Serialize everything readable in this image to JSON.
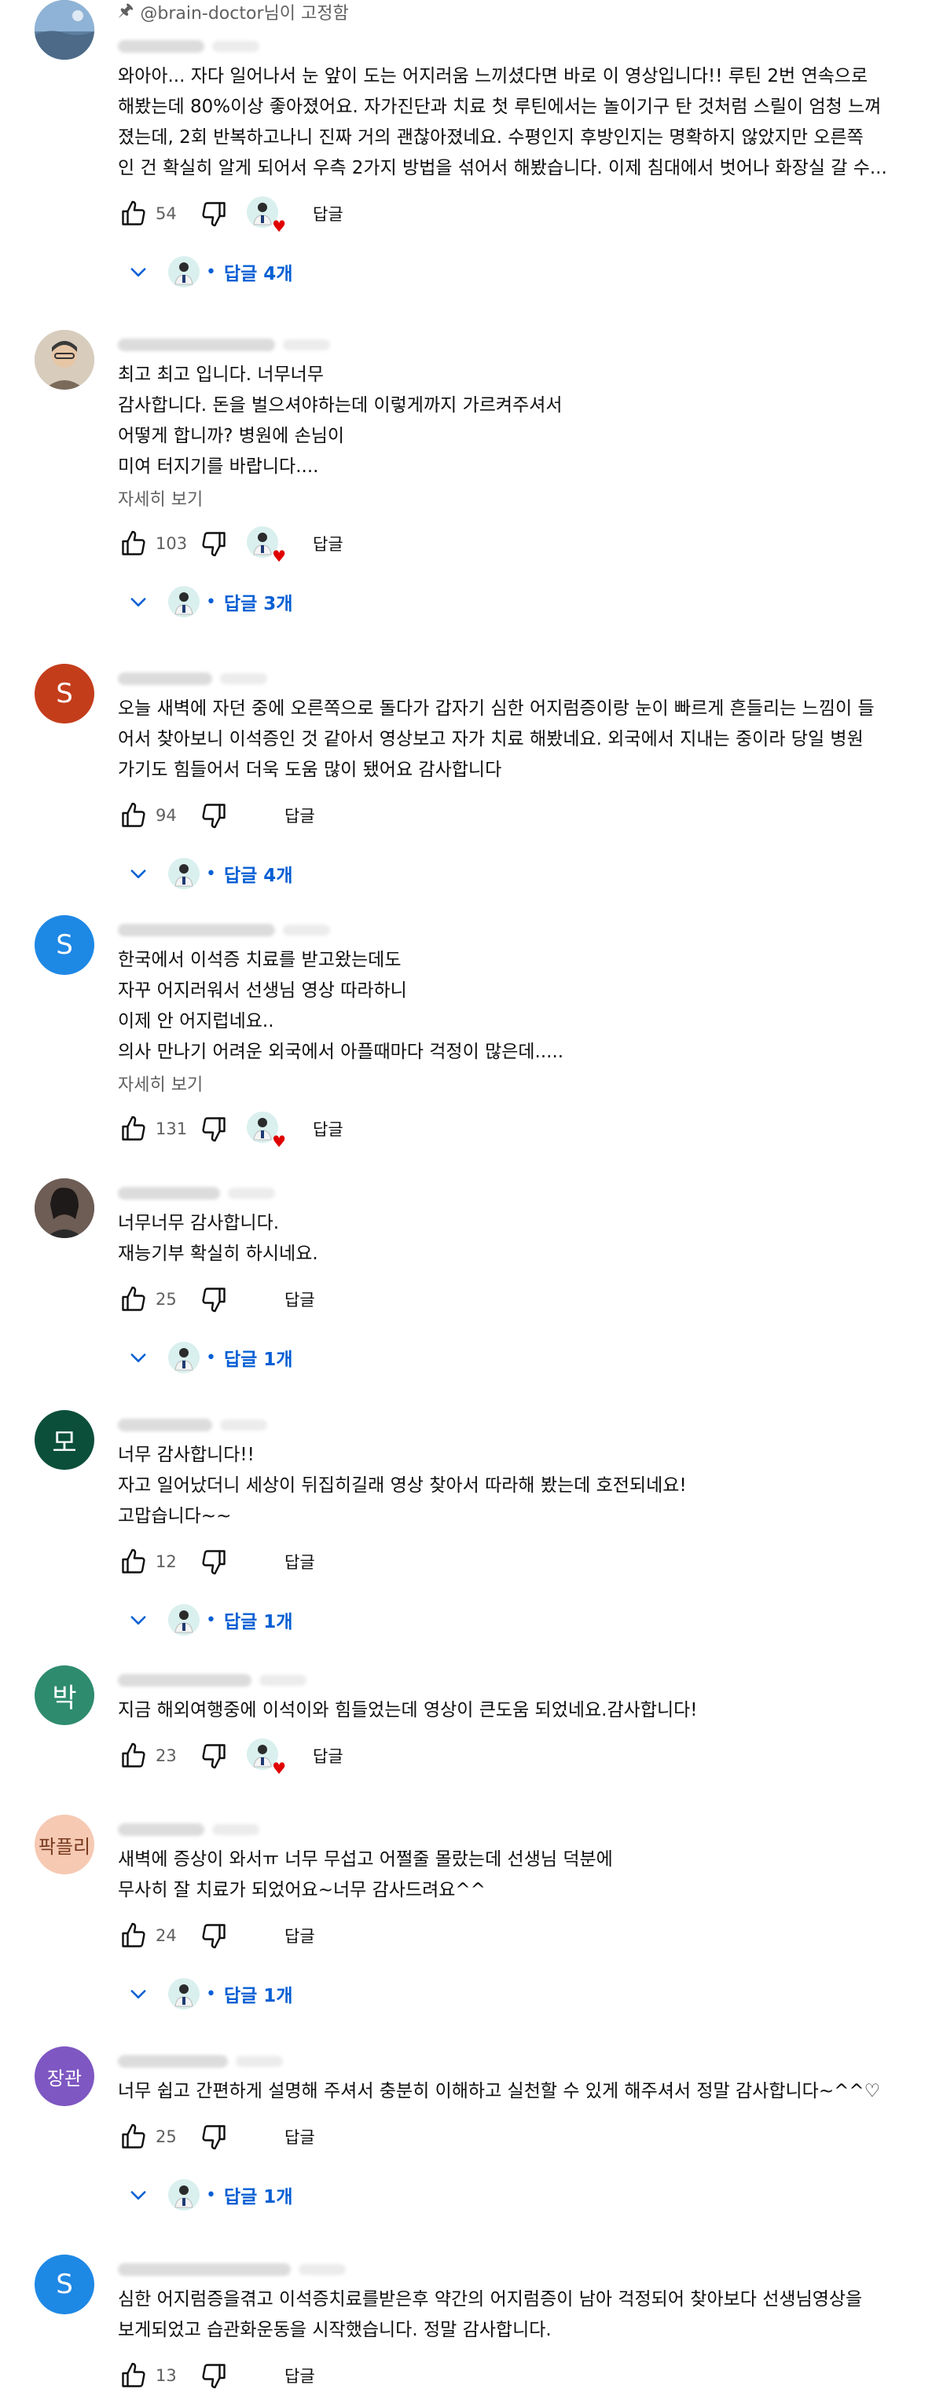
{
  "pinned_label": "@brain-doctor님이 고정함",
  "reply_label": "답글",
  "more_label": "자세히 보기",
  "colors": {
    "link_blue": "#065fd4",
    "heart_red": "#e00000",
    "secondary_text": "#606060"
  },
  "comments": [
    {
      "avatar_letter": "",
      "avatar_color": "#6f8fb3",
      "pinned": true,
      "lines": [
        "와아아... 자다 일어나서 눈 앞이 도는 어지러움 느끼셨다면 바로 이 영상입니다!! 루틴 2번 연속으로",
        "해봤는데 80%이상 좋아졌어요. 자가진단과 치료 첫 루틴에서는 놀이기구 탄 것처럼 스릴이 엄청 느껴",
        "졌는데, 2회 반복하고나니 진짜 거의 괜찮아졌네요. 수평인지 후방인지는 명확하지 않았지만 오른쪽",
        "인 건 확실히 알게 되어서 우측 2가지 방법을 섞어서 해봤습니다. 이제 침대에서 벗어나 화장실 갈 수..."
      ],
      "more": false,
      "likes": "54",
      "heart": true,
      "replies": "답글 4개"
    },
    {
      "avatar_letter": "",
      "avatar_color": "#b7a58f",
      "pinned": false,
      "lines": [
        "최고 최고 입니다.  너무너무",
        "감사합니다. 돈을 벌으셔야하는데 이렇게까지 가르켜주셔서",
        "어떻게 합니까? 병원에 손님이",
        "미여 터지기를 바랍니다...."
      ],
      "more": true,
      "likes": "103",
      "heart": true,
      "replies": "답글 3개"
    },
    {
      "avatar_letter": "S",
      "avatar_color": "#c43d1b",
      "pinned": false,
      "lines": [
        "오늘 새벽에 자던 중에 오른쪽으로 돌다가 갑자기 심한 어지럼증이랑 눈이 빠르게 흔들리는 느낌이 들",
        "어서 찾아보니 이석증인 것 같아서 영상보고 자가 치료 해봤네요. 외국에서 지내는 중이라 당일 병원",
        "가기도 힘들어서 더욱 도움 많이 됐어요 감사합니다"
      ],
      "more": false,
      "likes": "94",
      "heart": false,
      "replies": "답글 4개"
    },
    {
      "avatar_letter": "S",
      "avatar_color": "#1e88e5",
      "pinned": false,
      "lines": [
        "한국에서 이석증 치료를 받고왔는데도",
        "자꾸 어지러워서 선생님 영상 따라하니",
        "이제 안 어지럽네요..",
        "의사 만나기 어려운 외국에서 아플때마다 걱정이 많은데....."
      ],
      "more": true,
      "likes": "131",
      "heart": true,
      "replies": ""
    },
    {
      "avatar_letter": "",
      "avatar_color": "#5a4a44",
      "pinned": false,
      "lines": [
        "너무너무 감사합니다.",
        "재능기부 확실히 하시네요."
      ],
      "more": false,
      "likes": "25",
      "heart": false,
      "replies": "답글 1개"
    },
    {
      "avatar_letter": "모",
      "avatar_color": "#0b4f3a",
      "pinned": false,
      "lines": [
        "너무 감사합니다!!",
        "자고 일어났더니  세상이 뒤집히길래 영상 찾아서 따라해 봤는데 호전되네요!",
        "고맙습니다~~"
      ],
      "more": false,
      "likes": "12",
      "heart": false,
      "replies": "답글 1개"
    },
    {
      "avatar_letter": "박",
      "avatar_color": "#2e8b6e",
      "pinned": false,
      "lines": [
        "지금 해외여행중에 이석이와 힘들었는데 영상이 큰도움 되었네요.감사합니다!"
      ],
      "more": false,
      "likes": "23",
      "heart": true,
      "replies": ""
    },
    {
      "avatar_letter": "팍플리",
      "avatar_color": "#f6c9b3",
      "avatar_text_color": "#7a3b1f",
      "pinned": false,
      "lines": [
        "새벽에 증상이 와서ㅠ 너무 무섭고 어쩔줄 몰랐는데 선생님 덕분에",
        "무사히 잘 치료가 되었어요~너무 감사드려요^^"
      ],
      "more": false,
      "likes": "24",
      "heart": false,
      "replies": "답글 1개"
    },
    {
      "avatar_letter": "장관",
      "avatar_color": "#7e57c2",
      "pinned": false,
      "lines": [
        "너무 쉽고 간편하게 설명해 주셔서 충분히 이해하고 실천할 수 있게 해주셔서 정말 감사합니다~^^♡"
      ],
      "more": false,
      "likes": "25",
      "heart": false,
      "replies": "답글 1개"
    },
    {
      "avatar_letter": "S",
      "avatar_color": "#1e88e5",
      "pinned": false,
      "lines": [
        "심한 어지럼증을겪고 이석증치료를받은후 약간의 어지럼증이 남아 걱정되어 찾아보다 선생님영상을",
        "보게되었고 습관화운동을 시작했습니다. 정말 감사합니다."
      ],
      "more": false,
      "likes": "13",
      "heart": false,
      "replies": ""
    }
  ]
}
